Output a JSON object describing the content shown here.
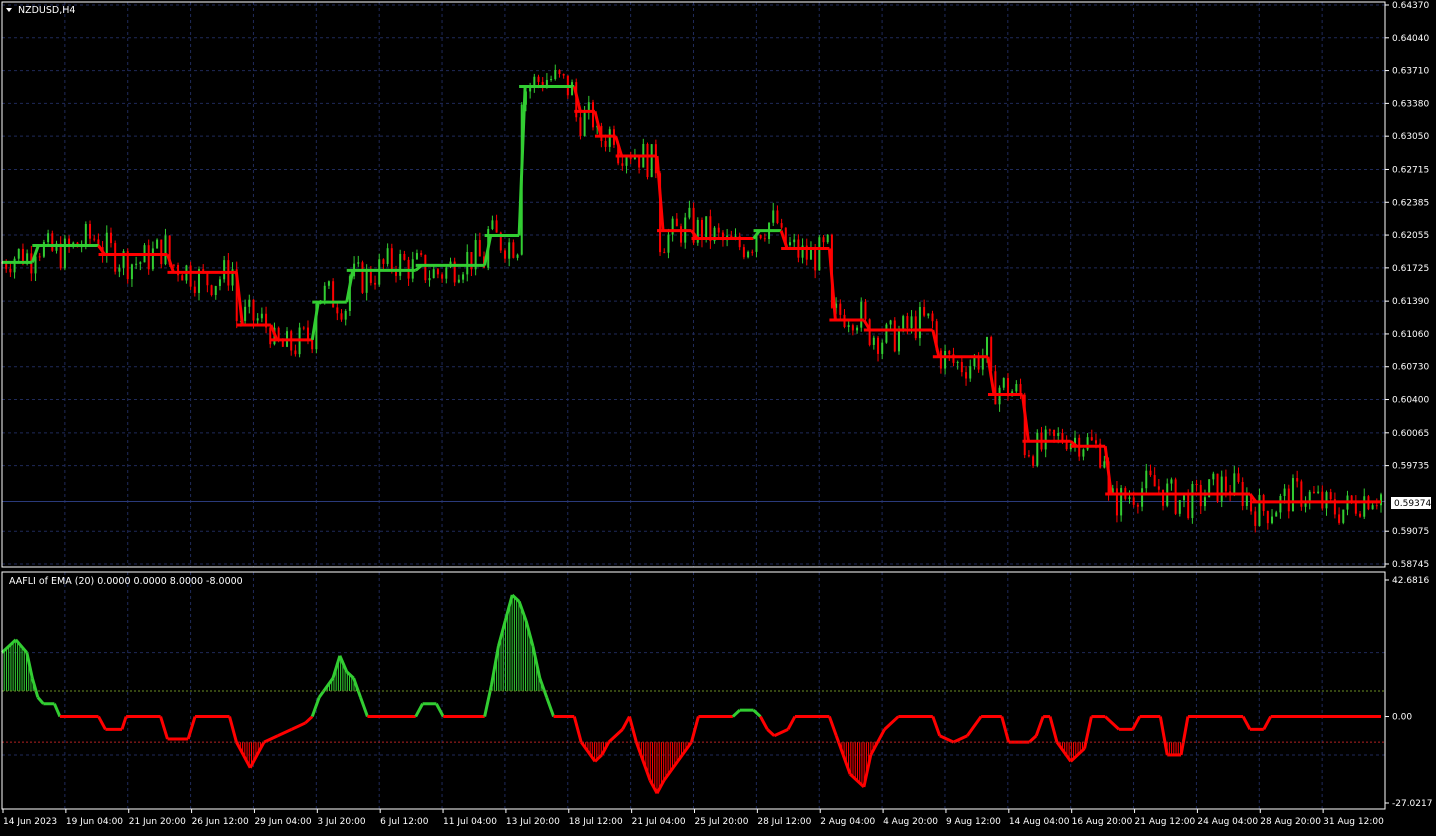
{
  "main_pane": {
    "title": "NZDUSD,H4",
    "current_price": "0.59374",
    "y_ticks": [
      "0.64370",
      "0.64040",
      "0.63710",
      "0.63380",
      "0.63050",
      "0.62715",
      "0.62385",
      "0.62055",
      "0.61725",
      "0.61390",
      "0.61060",
      "0.60730",
      "0.60400",
      "0.60065",
      "0.59735",
      "0.59374",
      "0.59075",
      "0.58745"
    ]
  },
  "indicator_pane": {
    "title": "AAFLI of EMA (20) 0.0000 0.0000 8.0000 -8.0000",
    "y_ticks": [
      "42.6816",
      "0.00",
      "-27.0217"
    ],
    "upper_level": 8,
    "lower_level": -8
  },
  "x_axis": {
    "labels": [
      "14 Jun 2023",
      "19 Jun 04:00",
      "21 Jun 20:00",
      "26 Jun 12:00",
      "29 Jun 04:00",
      "3 Jul 20:00",
      "6 Jul 12:00",
      "11 Jul 04:00",
      "13 Jul 20:00",
      "18 Jul 12:00",
      "21 Jul 04:00",
      "25 Jul 20:00",
      "28 Jul 12:00",
      "2 Aug 04:00",
      "4 Aug 20:00",
      "9 Aug 12:00",
      "14 Aug 04:00",
      "16 Aug 20:00",
      "21 Aug 12:00",
      "24 Aug 04:00",
      "28 Aug 20:00",
      "31 Aug 12:00"
    ]
  },
  "colors": {
    "background": "#000000",
    "grid": "#1f2a5a",
    "axis_text": "#ffffff",
    "bull": "#32cd32",
    "bear": "#ff0000",
    "level_up": "#6b8e23",
    "level_down": "#b22222"
  },
  "chart_data": [
    {
      "type": "line",
      "title": "NZDUSD,H4",
      "ylim": [
        0.58745,
        0.6437
      ],
      "series": [
        {
          "name": "",
          "trend_steps": [
            {
              "x": [
                0,
                0.022
              ],
              "y": 0.6178,
              "color": "bull"
            },
            {
              "x": [
                0.022,
                0.07
              ],
              "y": 0.6195,
              "color": "bull"
            },
            {
              "x": [
                0.07,
                0.12
              ],
              "y": 0.6186,
              "color": "bear"
            },
            {
              "x": [
                0.12,
                0.17
              ],
              "y": 0.6168,
              "color": "bear"
            },
            {
              "x": [
                0.17,
                0.195
              ],
              "y": 0.6115,
              "color": "bear"
            },
            {
              "x": [
                0.195,
                0.225
              ],
              "y": 0.61,
              "color": "bear"
            },
            {
              "x": [
                0.225,
                0.25
              ],
              "y": 0.6138,
              "color": "bull"
            },
            {
              "x": [
                0.25,
                0.3
              ],
              "y": 0.617,
              "color": "bull"
            },
            {
              "x": [
                0.3,
                0.35
              ],
              "y": 0.6175,
              "color": "bull"
            },
            {
              "x": [
                0.35,
                0.375
              ],
              "y": 0.6205,
              "color": "bull"
            },
            {
              "x": [
                0.375,
                0.415
              ],
              "y": 0.6355,
              "color": "bull"
            },
            {
              "x": [
                0.415,
                0.43
              ],
              "y": 0.633,
              "color": "bear"
            },
            {
              "x": [
                0.43,
                0.445
              ],
              "y": 0.6305,
              "color": "bear"
            },
            {
              "x": [
                0.445,
                0.475
              ],
              "y": 0.6285,
              "color": "bear"
            },
            {
              "x": [
                0.475,
                0.5
              ],
              "y": 0.621,
              "color": "bear"
            },
            {
              "x": [
                0.5,
                0.545
              ],
              "y": 0.6202,
              "color": "bear"
            },
            {
              "x": [
                0.545,
                0.565
              ],
              "y": 0.621,
              "color": "bull"
            },
            {
              "x": [
                0.565,
                0.6
              ],
              "y": 0.6192,
              "color": "bear"
            },
            {
              "x": [
                0.6,
                0.625
              ],
              "y": 0.612,
              "color": "bear"
            },
            {
              "x": [
                0.625,
                0.65
              ],
              "y": 0.611,
              "color": "bear"
            },
            {
              "x": [
                0.65,
                0.675
              ],
              "y": 0.611,
              "color": "bear"
            },
            {
              "x": [
                0.675,
                0.715
              ],
              "y": 0.6083,
              "color": "bear"
            },
            {
              "x": [
                0.715,
                0.74
              ],
              "y": 0.6045,
              "color": "bear"
            },
            {
              "x": [
                0.74,
                0.775
              ],
              "y": 0.5998,
              "color": "bear"
            },
            {
              "x": [
                0.775,
                0.8
              ],
              "y": 0.5993,
              "color": "bear"
            },
            {
              "x": [
                0.8,
                0.865
              ],
              "y": 0.5945,
              "color": "bear"
            },
            {
              "x": [
                0.865,
                0.905
              ],
              "y": 0.5945,
              "color": "bear"
            },
            {
              "x": [
                0.905,
                1.0
              ],
              "y": 0.5937,
              "color": "bear"
            }
          ]
        }
      ]
    },
    {
      "type": "area",
      "title": "AAFLI of EMA (20) 0.0000 0.0000 8.0000 -8.0000",
      "ylim": [
        -27.0217,
        42.6816
      ],
      "series": [
        {
          "name": "",
          "points": [
            [
              0,
              20
            ],
            [
              0.01,
              24
            ],
            [
              0.018,
              20
            ],
            [
              0.022,
              12
            ],
            [
              0.026,
              6
            ],
            [
              0.03,
              4
            ],
            [
              0.038,
              4
            ],
            [
              0.042,
              0
            ],
            [
              0.07,
              0
            ],
            [
              0.075,
              -4
            ],
            [
              0.087,
              -4
            ],
            [
              0.09,
              0
            ],
            [
              0.115,
              0
            ],
            [
              0.12,
              -7
            ],
            [
              0.135,
              -7
            ],
            [
              0.14,
              0
            ],
            [
              0.165,
              0
            ],
            [
              0.17,
              -8
            ],
            [
              0.18,
              -16
            ],
            [
              0.19,
              -8
            ],
            [
              0.2,
              -6
            ],
            [
              0.21,
              -4
            ],
            [
              0.22,
              -2
            ],
            [
              0.225,
              0
            ],
            [
              0.23,
              6
            ],
            [
              0.24,
              12
            ],
            [
              0.245,
              19
            ],
            [
              0.25,
              14
            ],
            [
              0.255,
              12
            ],
            [
              0.26,
              6
            ],
            [
              0.265,
              0
            ],
            [
              0.3,
              0
            ],
            [
              0.305,
              4
            ],
            [
              0.315,
              4
            ],
            [
              0.32,
              0
            ],
            [
              0.35,
              0
            ],
            [
              0.355,
              10
            ],
            [
              0.36,
              22
            ],
            [
              0.365,
              30
            ],
            [
              0.37,
              38
            ],
            [
              0.375,
              36
            ],
            [
              0.38,
              30
            ],
            [
              0.385,
              22
            ],
            [
              0.39,
              12
            ],
            [
              0.395,
              6
            ],
            [
              0.4,
              0
            ],
            [
              0.415,
              0
            ],
            [
              0.42,
              -8
            ],
            [
              0.43,
              -14
            ],
            [
              0.435,
              -12
            ],
            [
              0.44,
              -8
            ],
            [
              0.45,
              -4
            ],
            [
              0.455,
              0
            ],
            [
              0.46,
              -8
            ],
            [
              0.47,
              -20
            ],
            [
              0.475,
              -24
            ],
            [
              0.48,
              -20
            ],
            [
              0.49,
              -14
            ],
            [
              0.5,
              -8
            ],
            [
              0.505,
              0
            ],
            [
              0.53,
              0
            ],
            [
              0.535,
              2
            ],
            [
              0.545,
              2
            ],
            [
              0.55,
              0
            ],
            [
              0.555,
              -4
            ],
            [
              0.56,
              -6
            ],
            [
              0.57,
              -4
            ],
            [
              0.575,
              0
            ],
            [
              0.6,
              0
            ],
            [
              0.605,
              -6
            ],
            [
              0.615,
              -18
            ],
            [
              0.625,
              -22
            ],
            [
              0.63,
              -12
            ],
            [
              0.64,
              -4
            ],
            [
              0.65,
              0
            ],
            [
              0.675,
              0
            ],
            [
              0.68,
              -6
            ],
            [
              0.69,
              -8
            ],
            [
              0.7,
              -6
            ],
            [
              0.71,
              0
            ],
            [
              0.725,
              0
            ],
            [
              0.73,
              -8
            ],
            [
              0.745,
              -8
            ],
            [
              0.75,
              -6
            ],
            [
              0.755,
              0
            ],
            [
              0.76,
              0
            ],
            [
              0.765,
              -8
            ],
            [
              0.775,
              -14
            ],
            [
              0.785,
              -10
            ],
            [
              0.79,
              0
            ],
            [
              0.8,
              0
            ],
            [
              0.81,
              -4
            ],
            [
              0.82,
              -4
            ],
            [
              0.825,
              0
            ],
            [
              0.84,
              0
            ],
            [
              0.845,
              -12
            ],
            [
              0.855,
              -12
            ],
            [
              0.86,
              0
            ],
            [
              0.9,
              0
            ],
            [
              0.905,
              -4
            ],
            [
              0.915,
              -4
            ],
            [
              0.92,
              0
            ],
            [
              1.0,
              0
            ]
          ]
        }
      ]
    }
  ]
}
